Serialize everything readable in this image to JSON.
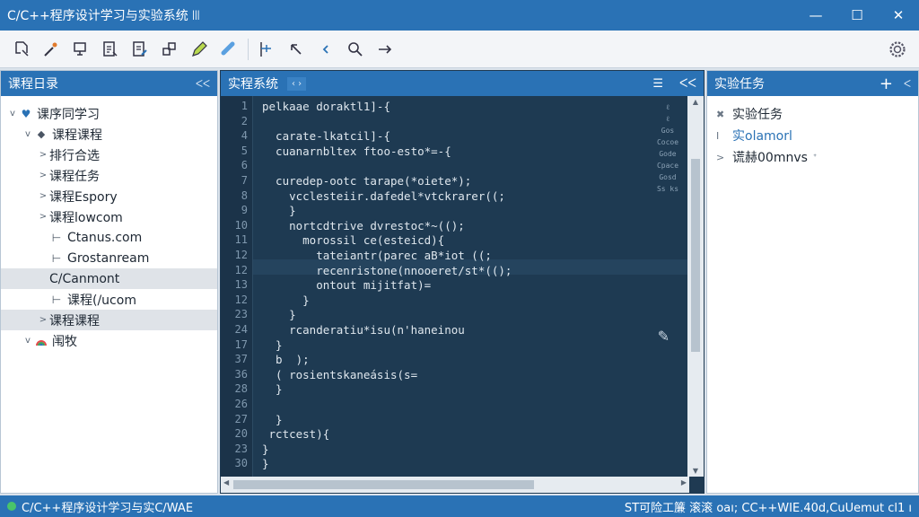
{
  "window": {
    "title": "C/C++程序设计学习与实验系统 ꔖ",
    "controls": {
      "minimize": "—",
      "maximize": "☐",
      "close": "✕"
    }
  },
  "toolbar": {
    "icons": [
      "new-file-icon",
      "magic-wand-icon",
      "monitor-icon",
      "document-list-icon",
      "edit-document-icon",
      "shapes-icon",
      "pencil-icon",
      "link-icon",
      "flag-icon",
      "undo-icon",
      "back-icon",
      "search-icon",
      "forward-icon",
      "settings-gear-icon"
    ]
  },
  "left_panel": {
    "title": "课程日录",
    "collapse": "ᐸᐸ",
    "tree": [
      {
        "label": "课序同学习",
        "caret": "v",
        "icon": "heart",
        "depth": 0
      },
      {
        "label": "课程课程",
        "caret": "v",
        "icon": "diamond",
        "depth": 1
      },
      {
        "label": "排行合选",
        "caret": ">",
        "icon": "",
        "depth": 2
      },
      {
        "label": "课程任务",
        "caret": ">",
        "icon": "",
        "depth": 2
      },
      {
        "label": "课程Espory",
        "caret": ">",
        "icon": "",
        "depth": 2
      },
      {
        "label": "课程lowcom",
        "caret": ">",
        "icon": "",
        "depth": 2
      },
      {
        "label": "Ctanus.com",
        "caret": "",
        "icon": "line",
        "depth": 2
      },
      {
        "label": "Grostanream",
        "caret": "",
        "icon": "line",
        "depth": 2
      },
      {
        "label": "C/Canmont",
        "caret": "",
        "icon": "",
        "depth": 2,
        "selected": true
      },
      {
        "label": "课程(/ucom",
        "caret": "",
        "icon": "line",
        "depth": 2
      },
      {
        "label": "课程课程",
        "caret": ">",
        "icon": "",
        "depth": 2,
        "selected": true
      },
      {
        "label": "闱牧",
        "caret": "v",
        "icon": "rainbow",
        "depth": 1
      }
    ]
  },
  "center_panel": {
    "title": "实程系统",
    "pin": "‹ ›",
    "menu": "☰",
    "collapse": "ᐸᐸ",
    "minimap": [
      "ℓ",
      "ℓ",
      "Gos",
      "Cocoe",
      "Gode",
      "Cpace",
      "Gosd",
      "Ss ks"
    ],
    "lines": [
      {
        "n": "1",
        "t": "pelkaae doraktl1]-{"
      },
      {
        "n": "2",
        "t": ""
      },
      {
        "n": "4",
        "t": "  carate-lkatcil]-{"
      },
      {
        "n": "5",
        "t": "  cuanarnbltex ftoo-esto*=-{"
      },
      {
        "n": "6",
        "t": ""
      },
      {
        "n": "7",
        "t": "  curedep-ootc tarape(*oiete*);"
      },
      {
        "n": "8",
        "t": "    vcclesteiir.dafedel*vtckrarer((;"
      },
      {
        "n": "9",
        "t": "    }"
      },
      {
        "n": "10",
        "t": "    nortcdtrive dvrestoc*~(();"
      },
      {
        "n": "11",
        "t": "      morossil ce(esteicd){"
      },
      {
        "n": "12",
        "t": "        tateiantr(parec aB*iot ((;"
      },
      {
        "n": "12",
        "t": "        recenristone(nnooeret/st*(();"
      },
      {
        "n": "13",
        "t": "        ontout mijitfat)="
      },
      {
        "n": "12",
        "t": "      }"
      },
      {
        "n": "23",
        "t": "    }"
      },
      {
        "n": "24",
        "t": "    rcanderatiu*isu(n'haneinou"
      },
      {
        "n": "17",
        "t": "  }"
      },
      {
        "n": "37",
        "t": "  b  );"
      },
      {
        "n": "36",
        "t": "  ( rosientskaneásis(s="
      },
      {
        "n": "28",
        "t": "  }"
      },
      {
        "n": "26",
        "t": ""
      },
      {
        "n": "27",
        "t": "  }"
      },
      {
        "n": "20",
        "t": " rctcest){"
      },
      {
        "n": "23",
        "t": "}"
      },
      {
        "n": "30",
        "t": "}"
      }
    ]
  },
  "right_panel": {
    "title": "实验任务",
    "add": "+",
    "collapse": "ᐸ",
    "items": [
      {
        "mark": "✖",
        "label": "实验任务",
        "link": false
      },
      {
        "mark": "I",
        "label": "实olamorl",
        "link": true
      },
      {
        "mark": ">",
        "label": "谎赫00mnvs",
        "link": false,
        "suffix": "ᐩ"
      }
    ]
  },
  "status": {
    "left": "C/C++程序设计学习与实C/WAE",
    "right": "ST可险工簾 滚滚 oaı; CC++WIE.40d,CuUemut cl1 ı"
  },
  "colors": {
    "title_bar": "#2a72b5",
    "editor_bg": "#1e3a52",
    "accent_link": "#2a72b5",
    "status_dot": "#49c46b"
  }
}
